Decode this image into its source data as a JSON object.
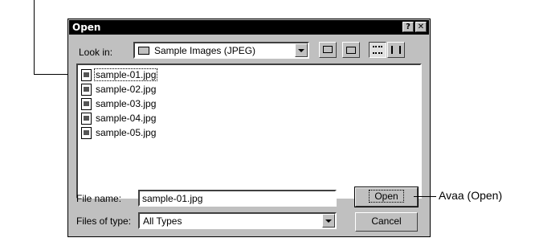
{
  "dialog": {
    "title": "Open",
    "help_glyph": "?",
    "close_glyph": "✕"
  },
  "look_in": {
    "label": "Look in:",
    "value": "Sample Images (JPEG)"
  },
  "files": [
    {
      "name": "sample-01.jpg",
      "selected": true
    },
    {
      "name": "sample-02.jpg",
      "selected": false
    },
    {
      "name": "sample-03.jpg",
      "selected": false
    },
    {
      "name": "sample-04.jpg",
      "selected": false
    },
    {
      "name": "sample-05.jpg",
      "selected": false
    }
  ],
  "file_name": {
    "label": "File name:",
    "value": "sample-01.jpg"
  },
  "file_type": {
    "label": "Files of type:",
    "value": "All Types"
  },
  "buttons": {
    "open": "Open",
    "cancel": "Cancel"
  },
  "annotation": {
    "open_callout": "Avaa (Open)"
  }
}
